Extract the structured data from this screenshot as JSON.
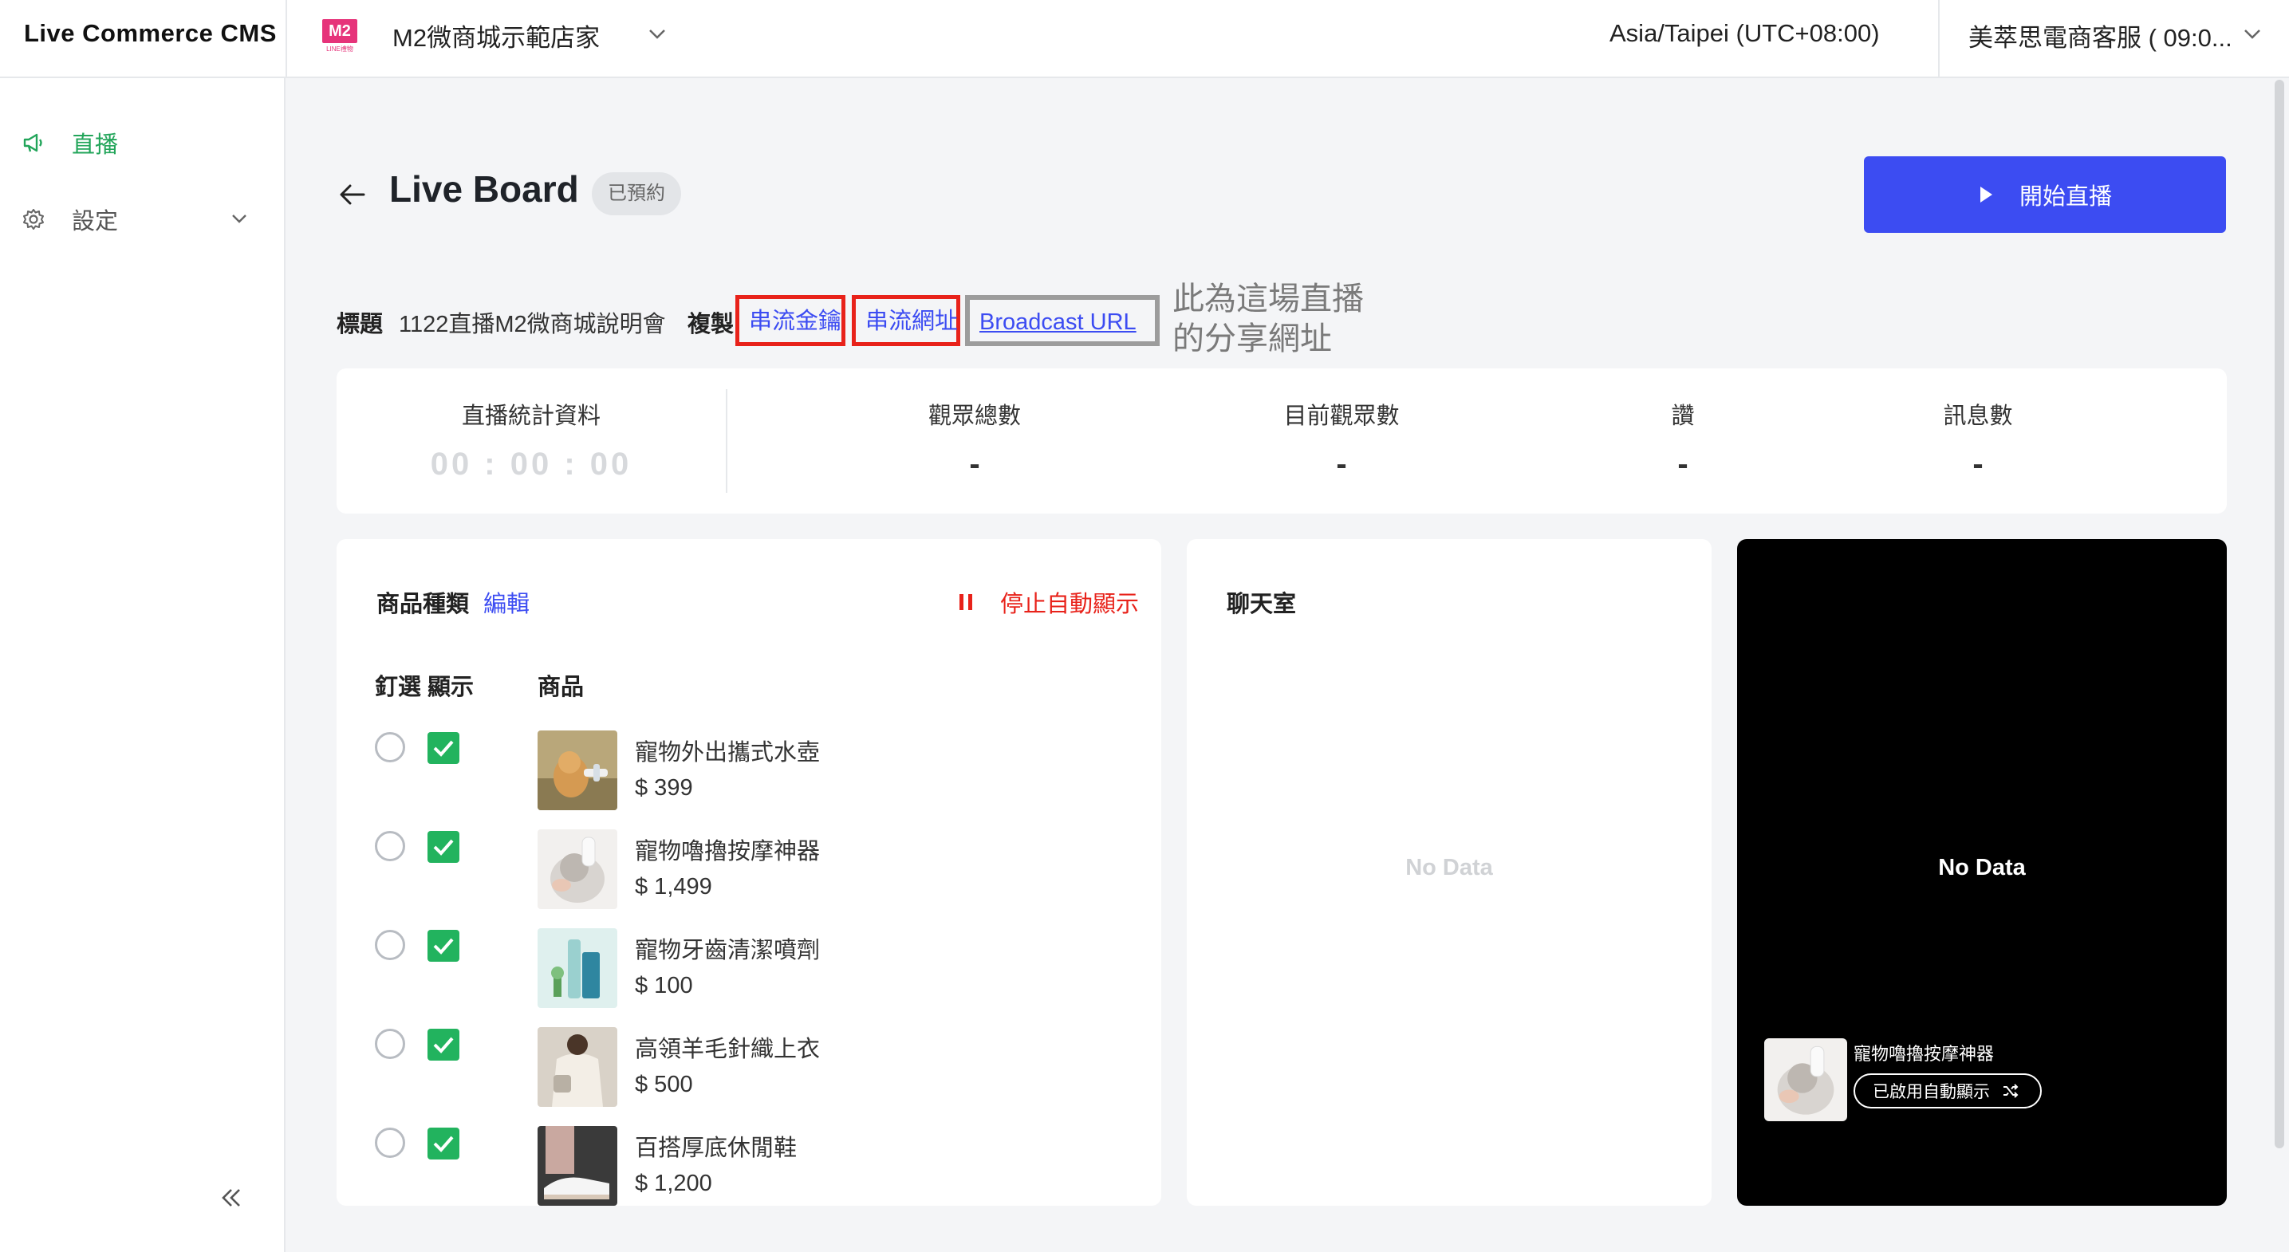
{
  "header": {
    "brand": "Live Commerce CMS",
    "store_logo_text": "M2",
    "store_logo_sub": "LINE禮物",
    "store_name": "M2微商城示範店家",
    "timezone": "Asia/Taipei (UTC+08:00)",
    "account": "美萃思電商客服 ( 09:0..."
  },
  "sidebar": {
    "items": [
      {
        "label": "直播",
        "icon": "megaphone-icon",
        "active": true
      },
      {
        "label": "設定",
        "icon": "gear-icon",
        "active": false
      }
    ]
  },
  "page": {
    "title": "Live Board",
    "status": "已預約",
    "start_button": "開始直播"
  },
  "info": {
    "title_label": "標題",
    "title_value": "1122直播M2微商城說明會",
    "copy_label": "複製",
    "stream_key": "串流金鑰",
    "stream_url": "串流網址",
    "broadcast_url": "Broadcast URL",
    "annotation_line1": "此為這場直播",
    "annotation_line2": "的分享網址"
  },
  "stats": {
    "duration_label": "直播統計資料",
    "duration_value": "00 : 00 : 00",
    "items": [
      {
        "label": "觀眾總數",
        "value": "-"
      },
      {
        "label": "目前觀眾數",
        "value": "-"
      },
      {
        "label": "讚",
        "value": "-"
      },
      {
        "label": "訊息數",
        "value": "-"
      }
    ]
  },
  "products": {
    "heading": "商品種類",
    "edit": "編輯",
    "stop_auto": "停止自動顯示",
    "col_pin": "釘選",
    "col_show": "顯示",
    "col_product": "商品",
    "rows": [
      {
        "name": "寵物外出攜式水壺",
        "price": "$ 399",
        "pinned": false,
        "shown": true
      },
      {
        "name": "寵物嚕擼按摩神器",
        "price": "$ 1,499",
        "pinned": false,
        "shown": true
      },
      {
        "name": "寵物牙齒清潔噴劑",
        "price": "$ 100",
        "pinned": false,
        "shown": true
      },
      {
        "name": "高領羊毛針織上衣",
        "price": "$ 500",
        "pinned": false,
        "shown": true
      },
      {
        "name": "百搭厚底休閒鞋",
        "price": "$ 1,200",
        "pinned": false,
        "shown": true
      }
    ]
  },
  "chat": {
    "title": "聊天室",
    "empty": "No Data"
  },
  "preview": {
    "empty": "No Data",
    "product_name": "寵物嚕擼按摩神器",
    "auto_pill": "已啟用自動顯示"
  },
  "colors": {
    "accent": "#3c4cf2",
    "active_green": "#22a55a",
    "checkbox_green": "#22b35e",
    "danger": "#e8221a"
  }
}
